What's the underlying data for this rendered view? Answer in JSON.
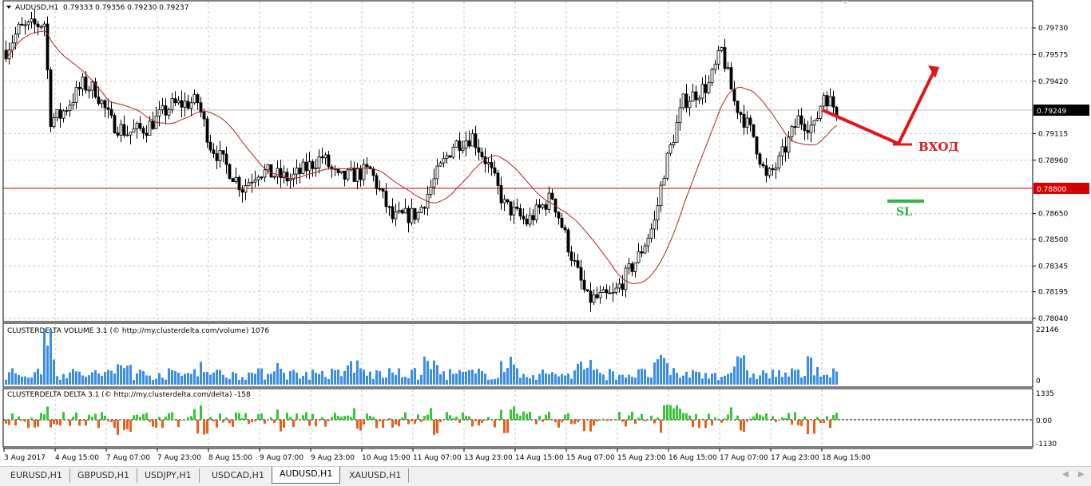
{
  "chart": {
    "symbol_label": "AUDUSD,H1",
    "ohlc": "0.79333 0.79356 0.79230 0.79237",
    "price_axis": [
      "0.79730",
      "0.79575",
      "0.79420",
      "0.79115",
      "0.78960",
      "0.78650",
      "0.78500",
      "0.78345",
      "0.78195",
      "0.78040"
    ],
    "current_price": "0.79249",
    "level_price": "0.78800",
    "price_path": [
      [
        0,
        0.796
      ],
      [
        4,
        0.7972
      ],
      [
        12,
        0.7976
      ],
      [
        13,
        0.7948
      ],
      [
        14,
        0.792
      ],
      [
        17,
        0.7922
      ],
      [
        24,
        0.794
      ],
      [
        28,
        0.7937
      ],
      [
        33,
        0.7918
      ],
      [
        38,
        0.7912
      ],
      [
        44,
        0.7915
      ],
      [
        52,
        0.7928
      ],
      [
        60,
        0.793
      ],
      [
        64,
        0.7905
      ],
      [
        74,
        0.788
      ],
      [
        79,
        0.789
      ],
      [
        89,
        0.7885
      ],
      [
        99,
        0.7898
      ],
      [
        104,
        0.7885
      ],
      [
        114,
        0.789
      ],
      [
        121,
        0.7862
      ],
      [
        129,
        0.7865
      ],
      [
        135,
        0.7888
      ],
      [
        140,
        0.7905
      ],
      [
        146,
        0.791
      ],
      [
        151,
        0.7893
      ],
      [
        156,
        0.787
      ],
      [
        163,
        0.786
      ],
      [
        171,
        0.7875
      ],
      [
        178,
        0.7835
      ],
      [
        182,
        0.7815
      ],
      [
        190,
        0.7817
      ],
      [
        198,
        0.784
      ],
      [
        203,
        0.786
      ],
      [
        206,
        0.789
      ],
      [
        212,
        0.793
      ],
      [
        220,
        0.794
      ],
      [
        224,
        0.796
      ],
      [
        228,
        0.793
      ],
      [
        234,
        0.791
      ],
      [
        238,
        0.7885
      ],
      [
        242,
        0.7895
      ],
      [
        248,
        0.792
      ],
      [
        253,
        0.7915
      ],
      [
        256,
        0.7935
      ],
      [
        260,
        0.7925
      ]
    ],
    "colors": {
      "level": "#d40000",
      "ma": "#b22222",
      "annotation": "#e0161b",
      "sl": "#33b44a"
    }
  },
  "annotations": {
    "entry": "ВХОД",
    "stop": "SL"
  },
  "volume_panel": {
    "title": "CLUSTERDELTA VOLUME 3.1 (© http://my.clusterdelta.com/volume) 1076",
    "max": "22146",
    "min": "0",
    "color": "#3a8ee6"
  },
  "delta_panel": {
    "title": "CLUSTERDELTA DELTA 3.1 (© http://my.clusterdelta.com/delta) -158",
    "max": "1335",
    "zero": "0.00",
    "min": "-1130",
    "pos_color": "#3cc43c",
    "neg_color": "#e8601c"
  },
  "time_axis": [
    "3 Aug 2017",
    "4 Aug 15:00",
    "7 Aug 07:00",
    "7 Aug 23:00",
    "8 Aug 15:00",
    "9 Aug 07:00",
    "9 Aug 23:00",
    "10 Aug 15:00",
    "11 Aug 07:00",
    "13 Aug 23:00",
    "14 Aug 15:00",
    "15 Aug 07:00",
    "15 Aug 23:00",
    "16 Aug 15:00",
    "17 Aug 07:00",
    "17 Aug 23:00",
    "18 Aug 15:00"
  ],
  "tabs": [
    "EURUSD,H1",
    "GBPUSD,H1",
    "USDJPY,H1",
    "USDCAD,H1",
    "AUDUSD,H1",
    "XAUUSD,H1"
  ],
  "active_tab": 4
}
